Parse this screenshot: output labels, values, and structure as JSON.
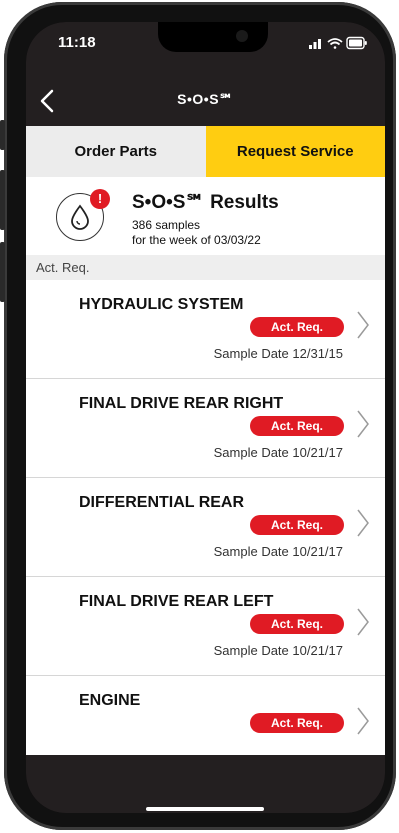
{
  "status": {
    "time": "11:18"
  },
  "nav": {
    "back_label": "<",
    "title": "S•O•S℠"
  },
  "tabs": [
    {
      "label": "Order Parts"
    },
    {
      "label": "Request Service"
    }
  ],
  "header": {
    "alert": "!",
    "title": "S•O•S℠ Results",
    "samples": "386 samples",
    "week": "for the week of 03/03/22"
  },
  "section": {
    "label": "Act. Req."
  },
  "rows": [
    {
      "title": "HYDRAULIC SYSTEM",
      "badge": "Act. Req.",
      "date": "Sample Date 12/31/15"
    },
    {
      "title": "FINAL DRIVE REAR RIGHT",
      "badge": "Act. Req.",
      "date": "Sample Date 10/21/17"
    },
    {
      "title": "DIFFERENTIAL REAR",
      "badge": "Act. Req.",
      "date": "Sample Date 10/21/17"
    },
    {
      "title": "FINAL DRIVE REAR LEFT",
      "badge": "Act. Req.",
      "date": "Sample Date 10/21/17"
    },
    {
      "title": "ENGINE",
      "badge": "Act. Req.",
      "date": ""
    }
  ],
  "colors": {
    "brand_yellow": "#ffcd11",
    "alert_red": "#e01b24",
    "bar_dark": "#231f20"
  },
  "icons": [
    "back-chevron-icon",
    "oil-drop-icon",
    "alert-icon",
    "chevron-right-icon",
    "signal-icon",
    "wifi-icon",
    "battery-icon"
  ]
}
